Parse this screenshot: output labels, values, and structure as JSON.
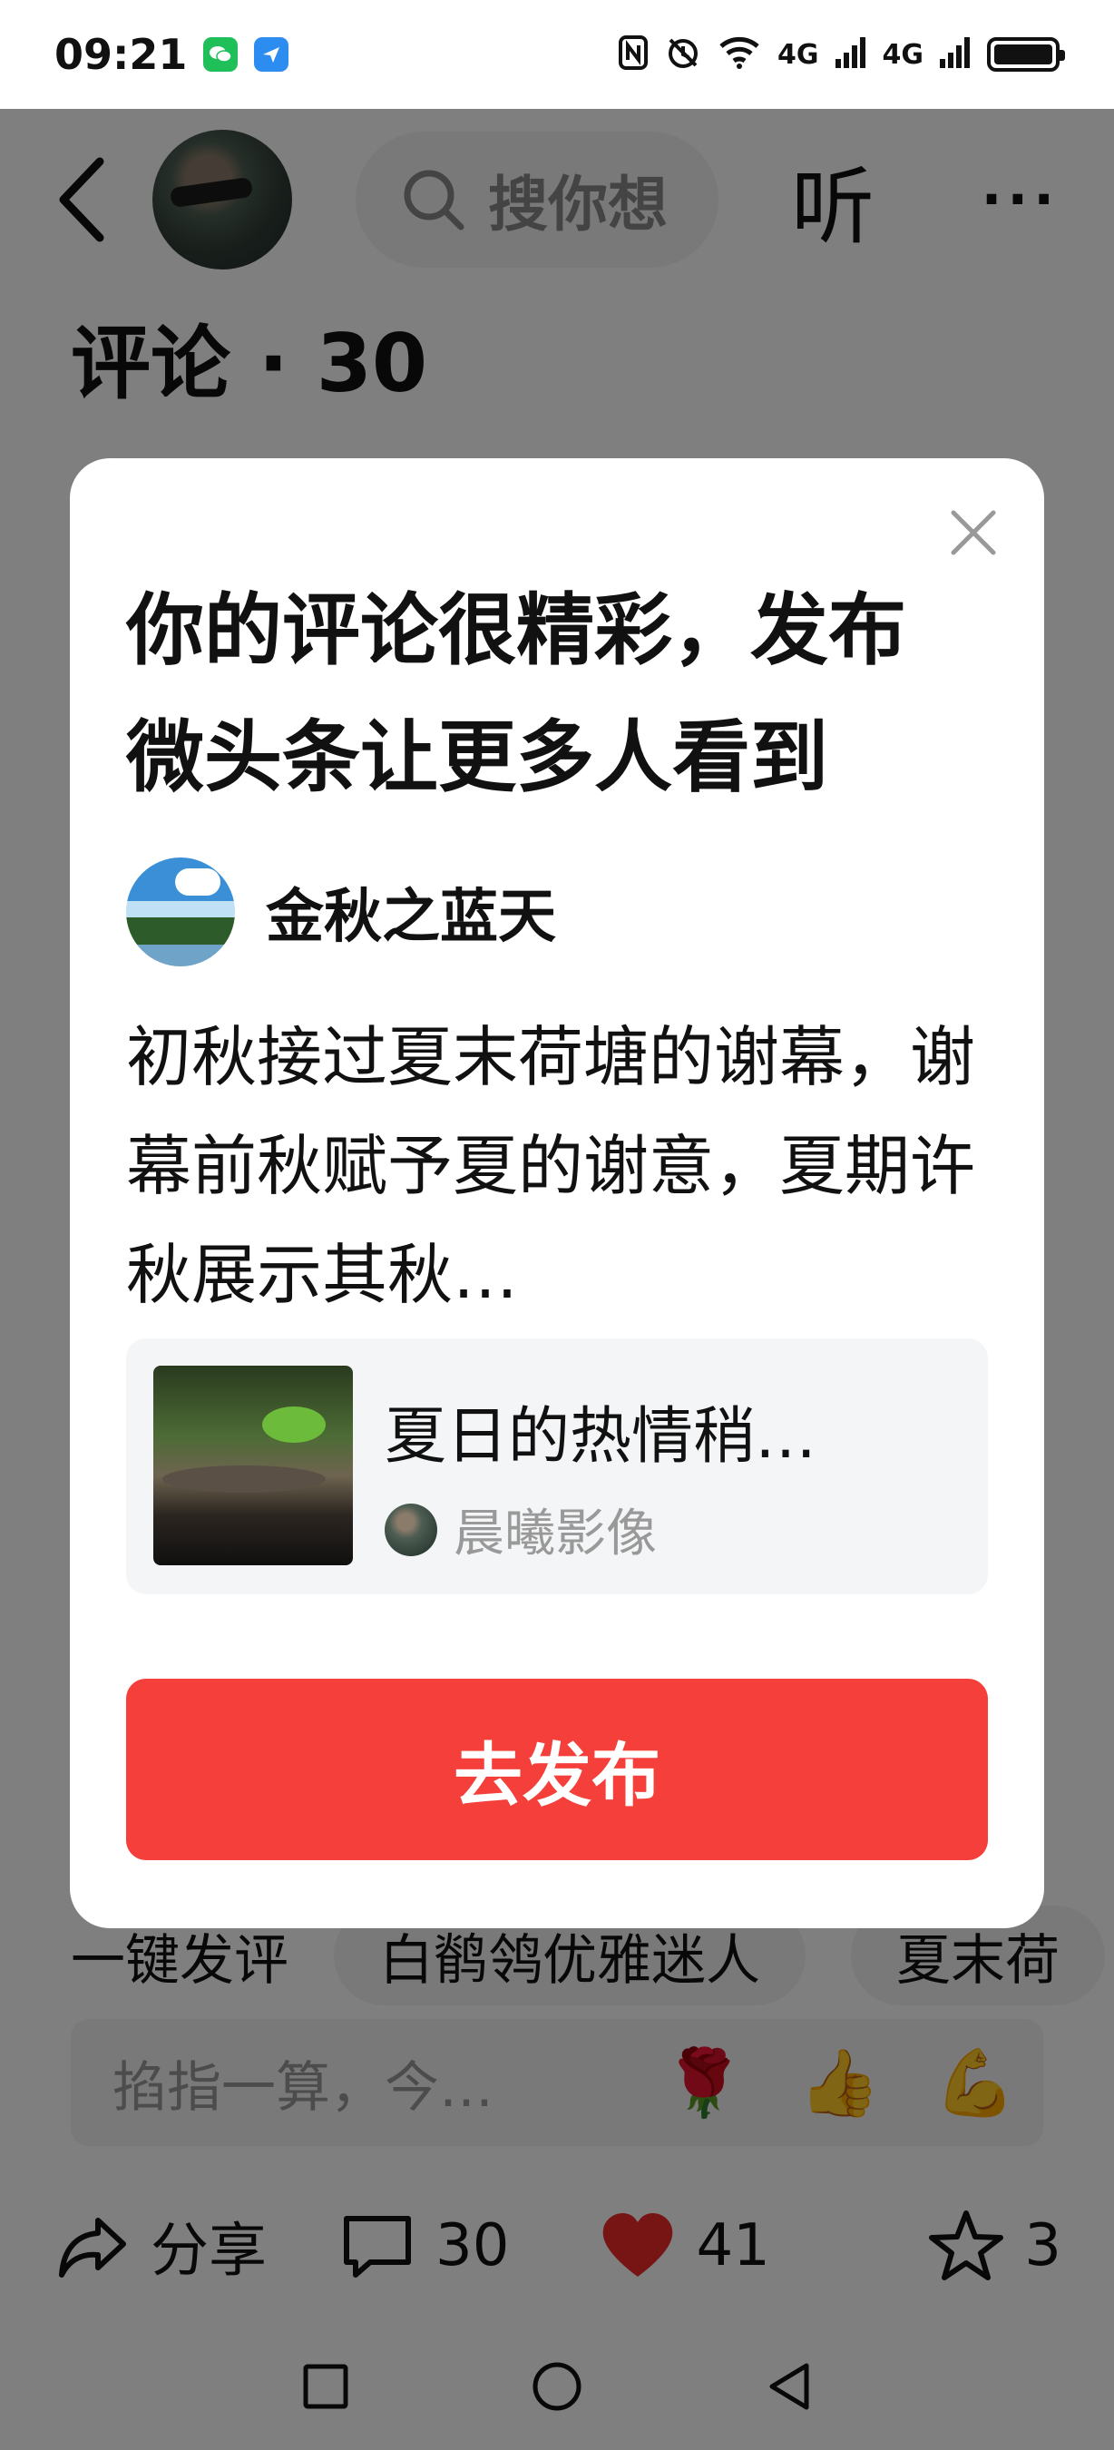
{
  "status_bar": {
    "time": "09:21",
    "network_labels": [
      "4G",
      "4G"
    ]
  },
  "top_nav": {
    "search_placeholder": "搜你想",
    "listen_label": "听",
    "more_label": "···"
  },
  "comments": {
    "title": "评论 · 30"
  },
  "dialog": {
    "title": "你的评论很精彩，发布微头条让更多人看到",
    "author_name": "金秋之蓝天",
    "comment_text": "初秋接过夏末荷塘的谢幕，谢幕前秋赋予夏的谢意，夏期许秋展示其秋…",
    "article": {
      "title": "夏日的热情稍…",
      "source": "晨曦影像"
    },
    "publish_button": "去发布"
  },
  "chips": [
    "一键发评",
    "白鹡鸰优雅迷人",
    "夏末荷"
  ],
  "comment_input": {
    "placeholder": "掐指一算，今…",
    "emojis": [
      "🌹",
      "👍",
      "💪"
    ]
  },
  "actions": {
    "share_label": "分享",
    "comment_count": "30",
    "like_count": "41",
    "favorite_count": "3"
  },
  "colors": {
    "accent_red": "#f43f3a",
    "overlay": "rgba(0,0,0,0.5)"
  }
}
